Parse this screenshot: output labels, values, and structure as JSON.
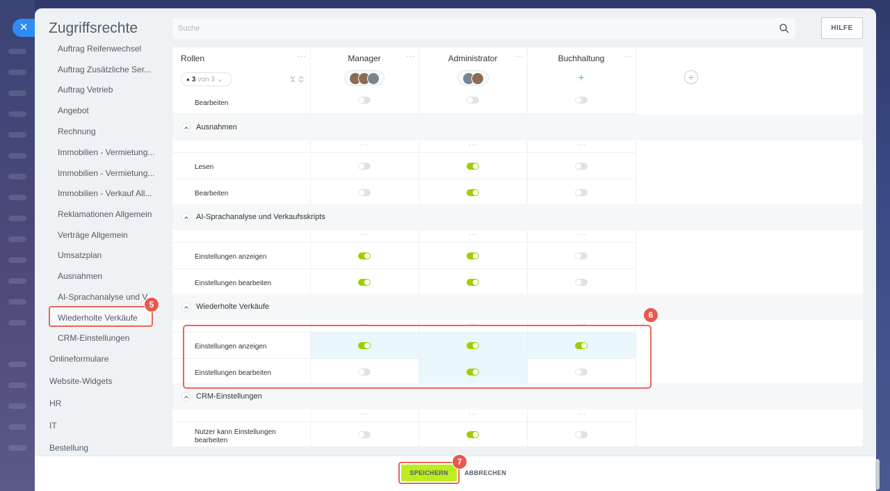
{
  "panel": {
    "title": "Zugriffsrechte"
  },
  "search": {
    "placeholder": "Suche"
  },
  "help_label": "HILFE",
  "sidebar": {
    "items": [
      {
        "label": "Auftrag Reifenwechsel",
        "level": "sub"
      },
      {
        "label": "Auftrag Zusätzliche Ser...",
        "level": "sub"
      },
      {
        "label": "Auftrag Vetrieb",
        "level": "sub"
      },
      {
        "label": "Angebot",
        "level": "sub"
      },
      {
        "label": "Rechnung",
        "level": "sub"
      },
      {
        "label": "Immobilien - Vermietung...",
        "level": "sub"
      },
      {
        "label": "Immobilien - Vermietung...",
        "level": "sub"
      },
      {
        "label": "Immobilien - Verkauf All...",
        "level": "sub"
      },
      {
        "label": "Reklamationen Allgemein",
        "level": "sub"
      },
      {
        "label": "Verträge Allgemein",
        "level": "sub"
      },
      {
        "label": "Umsatzplan",
        "level": "sub"
      },
      {
        "label": "Ausnahmen",
        "level": "sub"
      },
      {
        "label": "AI-Sprachanalyse und V...",
        "level": "sub"
      },
      {
        "label": "Wiederholte Verkäufe",
        "level": "sub",
        "active": true
      },
      {
        "label": "CRM-Einstellungen",
        "level": "sub"
      },
      {
        "label": "Onlineformulare",
        "level": "top"
      },
      {
        "label": "Website-Widgets",
        "level": "top"
      },
      {
        "label": "HR",
        "level": "top"
      },
      {
        "label": "IT",
        "level": "top"
      },
      {
        "label": "Bestellung",
        "level": "top"
      }
    ]
  },
  "badges": {
    "sidebar": "5",
    "table": "6",
    "save": "7"
  },
  "table": {
    "roles_label": "Rollen",
    "filter": {
      "count": "3",
      "suffix": "von 3"
    },
    "columns": [
      {
        "name": "Manager"
      },
      {
        "name": "Administrator"
      },
      {
        "name": "Buchhaltung"
      }
    ],
    "dots": "···",
    "top_row": {
      "label": "Bearbeiten",
      "values": [
        false,
        false,
        false
      ]
    },
    "sections": [
      {
        "title": "Ausnahmen",
        "rows": [
          {
            "label": "Lesen",
            "values": [
              false,
              true,
              false
            ]
          },
          {
            "label": "Bearbeiten",
            "values": [
              false,
              true,
              false
            ]
          }
        ]
      },
      {
        "title": "AI-Sprachanalyse und Verkaufsskripts",
        "rows": [
          {
            "label": "Einstellungen anzeigen",
            "values": [
              true,
              true,
              false
            ]
          },
          {
            "label": "Einstellungen bearbeiten",
            "values": [
              true,
              true,
              false
            ]
          }
        ]
      },
      {
        "title": "Wiederholte Verkäufe",
        "rows": [
          {
            "label": "Einstellungen anzeigen",
            "values": [
              true,
              true,
              true
            ]
          },
          {
            "label": "Einstellungen bearbeiten",
            "values": [
              false,
              true,
              false
            ]
          }
        ]
      },
      {
        "title": "CRM-Einstellungen",
        "rows": [
          {
            "label": "Nutzer kann Einstellungen bearbeiten",
            "values": [
              false,
              true,
              false
            ]
          }
        ]
      }
    ]
  },
  "footer": {
    "save_label": "SPEICHERN",
    "cancel_label": "ABBRECHEN"
  },
  "colors": {
    "toggle_on": "#9dcf00",
    "accent": "#2f8cf5",
    "highlight": "#e8665d",
    "save": "#bbed21"
  }
}
